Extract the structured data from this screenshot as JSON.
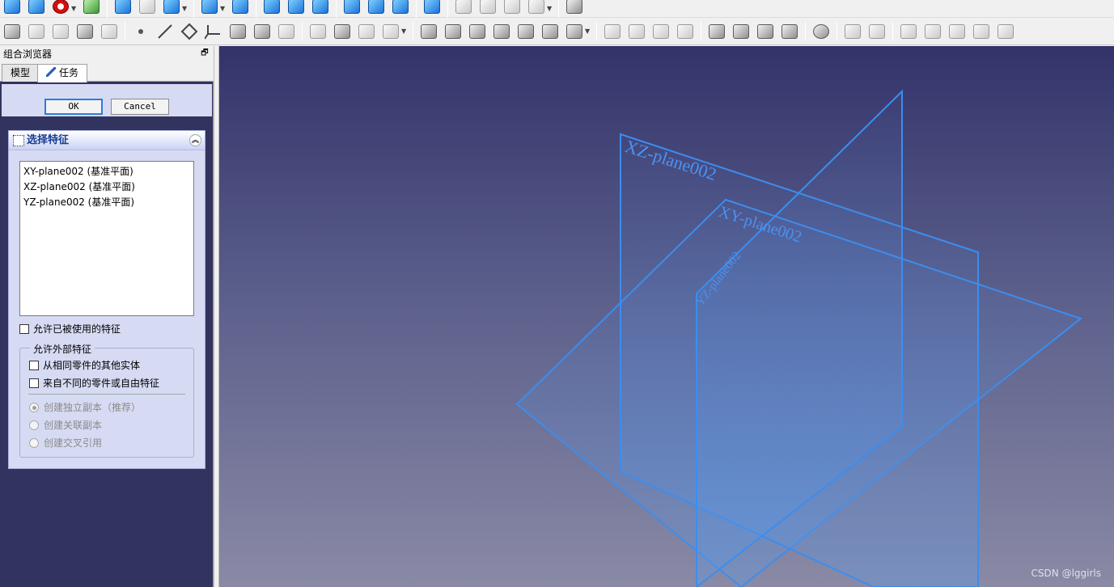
{
  "toolbar1": {
    "icons": [
      "fit-all-icon",
      "fit-selection-icon",
      "draw-style-icon",
      "sync-view-icon",
      "back-icon",
      "forward-icon",
      "workbench-icon",
      "zoom-icon",
      "view-axo-icon",
      "view-front-icon",
      "view-top-icon",
      "view-right-icon",
      "view-rear-icon",
      "view-bottom-icon",
      "view-left-icon",
      "measure-icon",
      "part-icon",
      "group-icon",
      "link-icon",
      "link-make-icon",
      "whats-this-icon"
    ]
  },
  "toolbar2": {
    "icons": [
      "body-icon",
      "shape-binder-icon",
      "sub-shape-binder-icon",
      "clone-icon",
      "create-sketch-icon",
      "datum-point-icon",
      "datum-line-icon",
      "datum-plane-icon",
      "local-cs-icon",
      "additive-pad-icon",
      "revolution-icon",
      "additive-loft-icon",
      "additive-pipe-icon",
      "helix-icon",
      "additive-primitive-icon",
      "pocket-icon",
      "hole-icon",
      "groove-icon",
      "subtractive-loft-icon",
      "subtractive-pipe-icon",
      "subtractive-helix-icon",
      "subtractive-primitive-icon",
      "mirrored-icon",
      "linear-pattern-icon",
      "polar-pattern-icon",
      "multi-transform-icon",
      "fillet-icon",
      "chamfer-icon",
      "draft-icon",
      "thickness-icon",
      "boolean-icon",
      "sprocket-icon",
      "involute-gear-icon",
      "shaft-wizard-icon",
      "hole-wizard-icon",
      "fem-icon",
      "section-icon"
    ]
  },
  "panel": {
    "title": "组合浏览器",
    "tab_model": "模型",
    "tab_task": "任务"
  },
  "dialog": {
    "ok_label": "OK",
    "cancel_label": "Cancel",
    "section_title": "选择特征",
    "features": [
      "XY-plane002 (基准平面)",
      "XZ-plane002 (基准平面)",
      "YZ-plane002 (基准平面)"
    ],
    "allow_used_label": "允许已被使用的特征",
    "allow_used_checked": false,
    "external_group_label": "允许外部特征",
    "opt_same_part_label": "从相同零件的其他实体",
    "opt_diff_part_label": "来自不同的零件或自由特征",
    "radio_independent_label": "创建独立副本（推荐）",
    "radio_dependent_label": "创建关联副本",
    "radio_xref_label": "创建交叉引用"
  },
  "viewport": {
    "plane_xz_label": "XZ-plane002",
    "plane_xy_label": "XY-plane002",
    "plane_yz_label": "YZ-plane002",
    "plane_color": "#3a8ef0",
    "watermark": "CSDN @lggirls"
  }
}
